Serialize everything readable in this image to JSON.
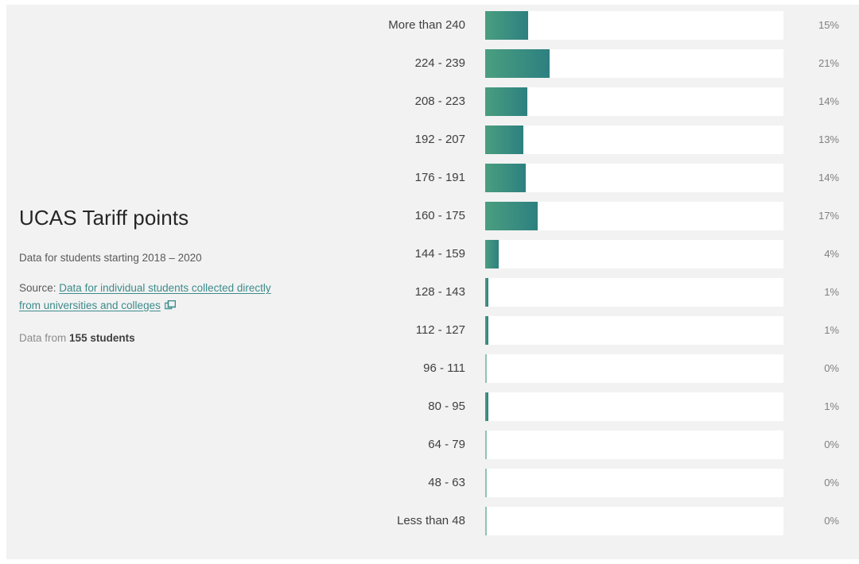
{
  "panel": {
    "title": "UCAS Tariff points",
    "period_line": "Data for students starting 2018 – 2020",
    "source_prefix": "Source:",
    "source_link": "Data for individual students collected directly from universities and colleges",
    "external_link_icon": "open-in-new-window-icon",
    "students_prefix": "Data from",
    "students_count": "155 students"
  },
  "colors": {
    "background": "#f2f2f2",
    "track": "#ffffff",
    "bar_gradient_start": "#4a9e7f",
    "bar_gradient_end": "#2d8080",
    "bar_zero": "#8fc3ae",
    "link": "#3d8b8b",
    "title_text": "#262626",
    "category_text": "#3f3f3f",
    "percent_text": "#808080"
  },
  "chart_data": {
    "type": "bar",
    "orientation": "horizontal",
    "title": "UCAS Tariff points",
    "xlabel": "",
    "ylabel": "",
    "xlim": [
      0,
      100
    ],
    "grid": false,
    "legend": false,
    "value_suffix": "%",
    "categories": [
      "More than 240",
      "224 - 239",
      "208 - 223",
      "192 - 207",
      "176 - 191",
      "160 - 175",
      "144 - 159",
      "128 - 143",
      "112 - 127",
      "96 - 111",
      "80 - 95",
      "64 - 79",
      "48 - 63",
      "Less than 48"
    ],
    "values": [
      15,
      21,
      14,
      13,
      14,
      17,
      4,
      1,
      1,
      0,
      1,
      0,
      0,
      0
    ],
    "labels": [
      "15%",
      "21%",
      "14%",
      "13%",
      "14%",
      "17%",
      "4%",
      "1%",
      "1%",
      "0%",
      "1%",
      "0%",
      "0%",
      "0%"
    ]
  },
  "rows": [
    {
      "label": "More than 240",
      "pct": "15%",
      "width": "14.4%",
      "zero": false
    },
    {
      "label": "224 - 239",
      "pct": "21%",
      "width": "21.6%",
      "zero": false
    },
    {
      "label": "208 - 223",
      "pct": "14%",
      "width": "14.1%",
      "zero": false
    },
    {
      "label": "192 - 207",
      "pct": "13%",
      "width": "12.8%",
      "zero": false
    },
    {
      "label": "176 - 191",
      "pct": "14%",
      "width": "13.6%",
      "zero": false
    },
    {
      "label": "160 - 175",
      "pct": "17%",
      "width": "17.6%",
      "zero": false
    },
    {
      "label": "144 - 159",
      "pct": "4%",
      "width": "4.5%",
      "zero": false
    },
    {
      "label": "128 - 143",
      "pct": "1%",
      "width": "1.1%",
      "zero": false
    },
    {
      "label": "112 - 127",
      "pct": "1%",
      "width": "1.1%",
      "zero": false
    },
    {
      "label": "96 - 111",
      "pct": "0%",
      "width": "0.55%",
      "zero": true
    },
    {
      "label": "80 - 95",
      "pct": "1%",
      "width": "1.1%",
      "zero": false
    },
    {
      "label": "64 - 79",
      "pct": "0%",
      "width": "0.55%",
      "zero": true
    },
    {
      "label": "48 - 63",
      "pct": "0%",
      "width": "0.55%",
      "zero": true
    },
    {
      "label": "Less than 48",
      "pct": "0%",
      "width": "0.55%",
      "zero": true
    }
  ]
}
